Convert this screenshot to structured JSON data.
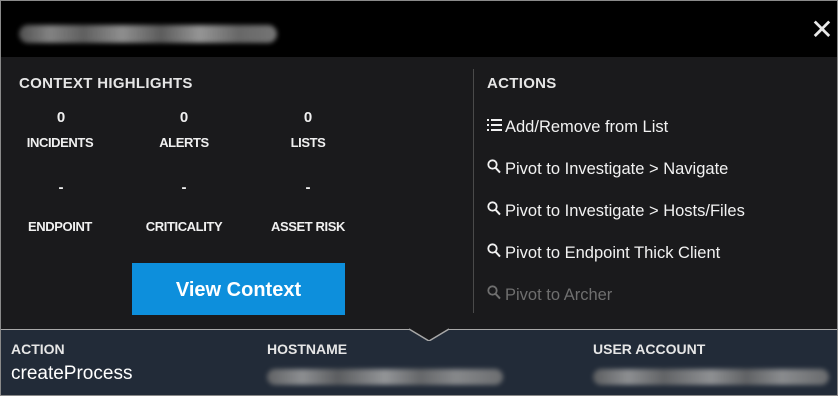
{
  "header": {
    "close_icon": "close-icon"
  },
  "context": {
    "title": "CONTEXT HIGHLIGHTS",
    "metrics_row1": [
      {
        "value": "0",
        "label": "INCIDENTS"
      },
      {
        "value": "0",
        "label": "ALERTS"
      },
      {
        "value": "0",
        "label": "LISTS"
      }
    ],
    "metrics_row2": [
      {
        "value": "-",
        "label": "ENDPOINT"
      },
      {
        "value": "-",
        "label": "CRITICALITY"
      },
      {
        "value": "-",
        "label": "ASSET RISK"
      }
    ],
    "view_button": "View Context"
  },
  "actions": {
    "title": "ACTIONS",
    "items": [
      {
        "icon": "list-icon",
        "label": "Add/Remove from List",
        "enabled": true
      },
      {
        "icon": "search-icon",
        "label": "Pivot to Investigate > Navigate",
        "enabled": true
      },
      {
        "icon": "search-icon",
        "label": "Pivot to Investigate > Hosts/Files",
        "enabled": true
      },
      {
        "icon": "search-icon",
        "label": "Pivot to Endpoint Thick Client",
        "enabled": true
      },
      {
        "icon": "search-icon",
        "label": "Pivot to Archer",
        "enabled": false
      }
    ]
  },
  "footer": {
    "action_label": "ACTION",
    "action_value": "createProcess",
    "hostname_label": "HOSTNAME",
    "user_account_label": "USER ACCOUNT"
  },
  "colors": {
    "panel_bg": "#1a1a1c",
    "header_bg": "#000000",
    "button_bg": "#0d8fdc",
    "footer_bg": "#222b38",
    "disabled_text": "#6f6f6f"
  }
}
